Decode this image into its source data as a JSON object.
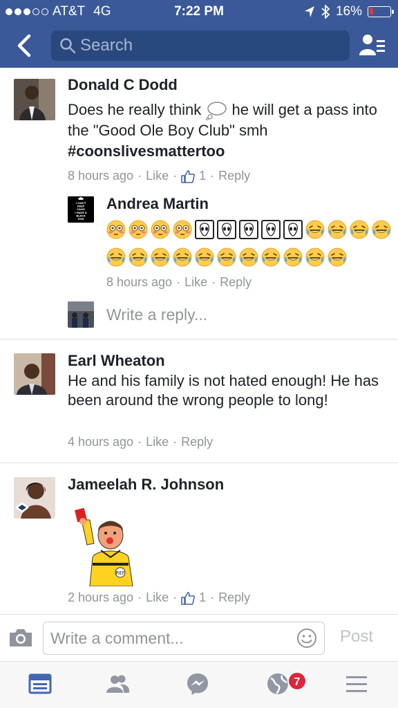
{
  "status_bar": {
    "carrier": "AT&T",
    "network": "4G",
    "time": "7:22 PM",
    "battery_percent": "16%",
    "signal_bars_filled": 3,
    "signal_bars_total": 5
  },
  "nav": {
    "search_placeholder": "Search"
  },
  "comments": [
    {
      "author": "Donald C Dodd",
      "text_part1": "Does he really think",
      "text_part2": "he will get a pass into the \"Good Ole Boy Club\" smh",
      "hashtag": "#coonslivesmattertoo",
      "time": "8 hours ago",
      "like_label": "Like",
      "like_count": "1",
      "reply_label": "Reply",
      "avatar_icon": "person-photo-avatar"
    },
    {
      "author": "Earl Wheaton",
      "text": "He and his family is not hated enough! He has been around the wrong people to long!",
      "time": "4 hours ago",
      "like_label": "Like",
      "reply_label": "Reply",
      "avatar_icon": "person-photo-avatar"
    },
    {
      "author": "Jameelah R. Johnson",
      "time": "2 hours ago",
      "like_label": "Like",
      "like_count": "1",
      "reply_label": "Reply",
      "sticker": "referee-red-card-sticker",
      "sticker_badge": "REF",
      "avatar_icon": "person-photo-avatar"
    }
  ],
  "reply": {
    "author": "Andrea Martin",
    "avatar_lines": [
      "I CAN'T",
      "KEEP",
      "CALM",
      "I HAVE A",
      "BLACK",
      "SON"
    ],
    "emoji_row1": [
      "flushed",
      "flushed",
      "flushed",
      "flushed",
      "alien-framed",
      "alien-framed",
      "alien-framed",
      "alien-framed",
      "alien-framed",
      "joy",
      "joy",
      "joy",
      "joy"
    ],
    "emoji_row2": [
      "joy",
      "joy",
      "joy",
      "joy",
      "joy",
      "joy",
      "joy",
      "joy",
      "joy",
      "joy",
      "joy"
    ],
    "time": "8 hours ago",
    "like_label": "Like",
    "reply_label": "Reply"
  },
  "reply_prompt": "Write a reply...",
  "composer": {
    "placeholder": "Write a comment...",
    "post_label": "Post"
  },
  "tabbar": {
    "notifications_badge": "7"
  },
  "colors": {
    "header_bg": "#3b5998",
    "search_bg": "#29487d",
    "meta_gray": "#90949c",
    "like_blue": "#4267b2",
    "badge_red": "#e0253a"
  }
}
